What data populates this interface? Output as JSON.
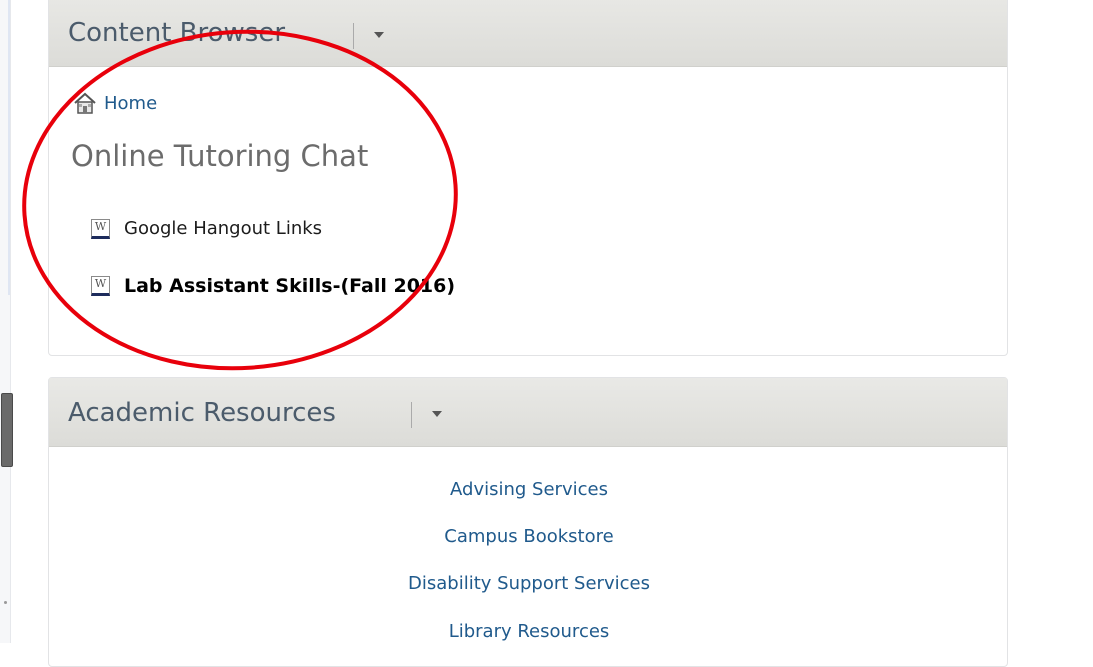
{
  "content_browser": {
    "title": "Content Browser",
    "home_label": "Home",
    "module_title": "Online Tutoring Chat",
    "topics": [
      {
        "label": "Google Hangout Links",
        "icon_letter": "W"
      },
      {
        "label": "Lab Assistant Skills-(Fall 2016)",
        "icon_letter": "W"
      }
    ]
  },
  "academic_resources": {
    "title": "Academic Resources",
    "links": [
      "Advising Services",
      "Campus Bookstore",
      "Disability Support Services",
      "Library Resources"
    ]
  },
  "icons": {
    "home": "home-icon",
    "topic": "word-document-icon",
    "menu": "chevron-down-icon"
  },
  "colors": {
    "link": "#205a8c",
    "header_bg": "#dcdcd8",
    "annotation": "#e8000b"
  }
}
